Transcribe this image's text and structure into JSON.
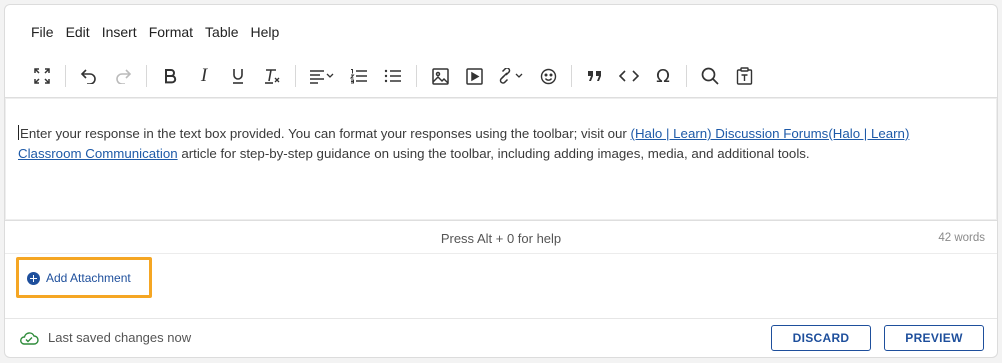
{
  "menu": {
    "items": [
      {
        "label": "File"
      },
      {
        "label": "Edit"
      },
      {
        "label": "Insert"
      },
      {
        "label": "Format"
      },
      {
        "label": "Table"
      },
      {
        "label": "Help"
      }
    ]
  },
  "toolbar": {
    "buttons": [
      "fullscreen-icon",
      "undo-icon",
      "redo-icon",
      "bold-icon",
      "italic-icon",
      "underline-icon",
      "clear-formatting-icon",
      "align-icon",
      "numbered-list-icon",
      "bullet-list-icon",
      "image-icon",
      "media-icon",
      "link-icon",
      "emoji-icon",
      "blockquote-icon",
      "code-icon",
      "special-character-icon",
      "search-icon",
      "paste-text-icon"
    ],
    "italic_glyph": "I",
    "omega_glyph": "Ω"
  },
  "editor": {
    "text_before": "Enter your response in the text box provided. You can format your responses using the toolbar; visit our ",
    "link_text": "(Halo | Learn) Discussion Forums(Halo | Learn) Classroom Communication",
    "text_after": " article for step-by-step guidance on using the toolbar, including adding images, media, and additional tools."
  },
  "status": {
    "help_hint": "Press Alt + 0 for help",
    "word_count": "42 words"
  },
  "attachment": {
    "label": "Add Attachment"
  },
  "footer": {
    "saved_text": "Last saved changes now",
    "discard_label": "DISCARD",
    "preview_label": "PREVIEW"
  },
  "colors": {
    "accent": "#1e4f9c",
    "highlight": "#f5a623",
    "saved_icon": "#2e8b3a"
  }
}
